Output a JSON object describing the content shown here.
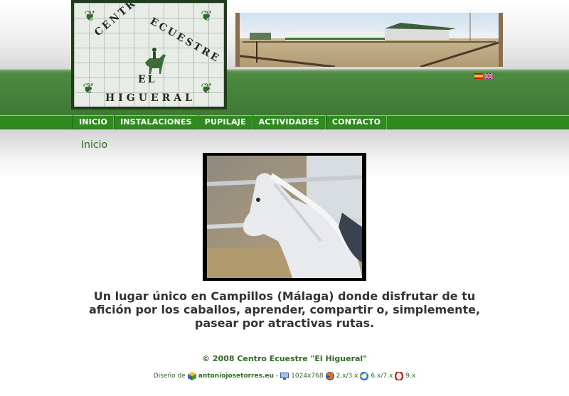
{
  "logo": {
    "line1": "CENTRO",
    "line2": "ECUESTRE",
    "line3": "EL",
    "line4": "HIGUERAL"
  },
  "nav": {
    "items": [
      "INICIO",
      "INSTALACIONES",
      "PUPILAJE",
      "ACTIVIDADES",
      "CONTACTO"
    ]
  },
  "page": {
    "heading": "Inicio",
    "tagline": "Un lugar único en Campillos (Málaga) donde disfrutar de tu afición por los caballos, aprender, compartir o, simplemente, pasear por atractivas rutas."
  },
  "footer": {
    "copyright": "© 2008 Centro Ecuestre \"El Higueral\"",
    "design_label": "Diseño de",
    "designer": "antoniojosetorres.eu",
    "separator": "-",
    "resolution": "1024x768",
    "firefox": "2.x/3.x",
    "ie": "6.x/7.x",
    "opera": "9.x"
  },
  "colors": {
    "green_band": "#3f7a35",
    "menu_green": "#2f8a1f",
    "text_green": "#2f6a24",
    "tagline": "#333333"
  },
  "icons": {
    "spanish_flag": "flag-es-icon",
    "english_flag": "flag-gb-icon",
    "designer_logo": "cube-icon",
    "monitor": "monitor-icon",
    "firefox": "firefox-icon",
    "ie": "ie-icon",
    "opera": "opera-icon"
  }
}
